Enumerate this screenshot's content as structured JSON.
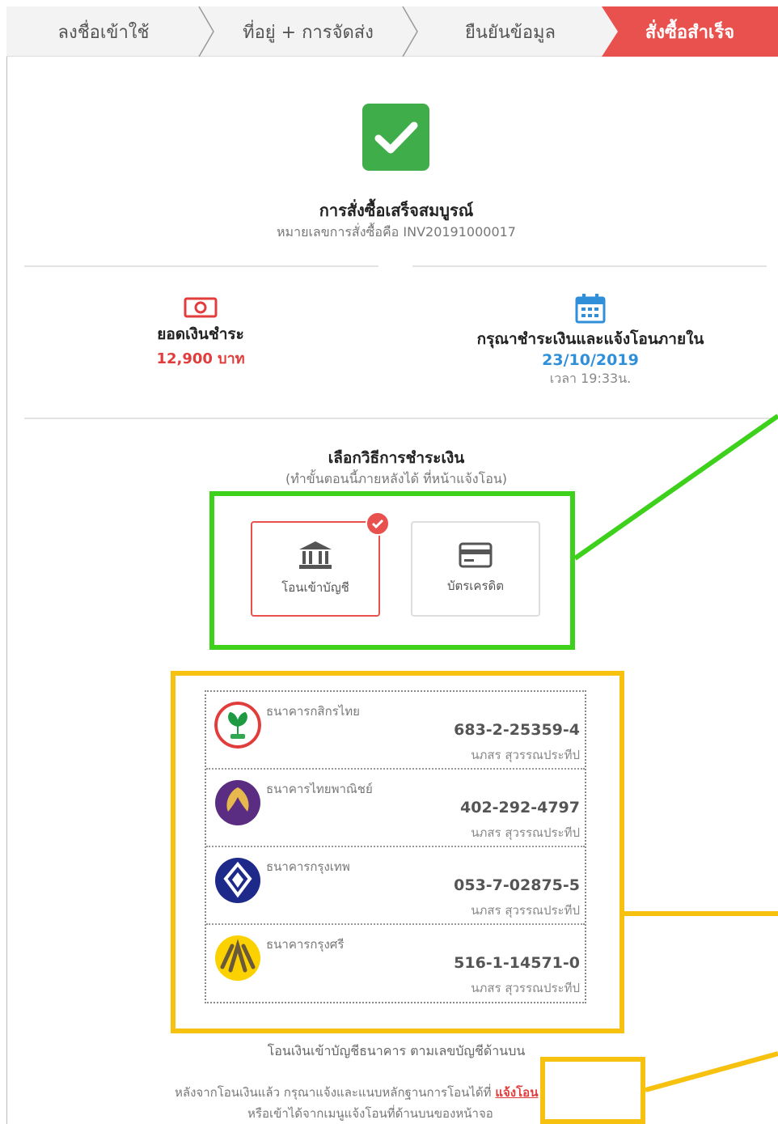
{
  "stepper": {
    "steps": [
      "ลงชื่อเข้าใช้",
      "ที่อยู่ + การจัดส่ง",
      "ยืนยันข้อมูล",
      "สั่งซื้อสำเร็จ"
    ],
    "active_color": "#e9514f"
  },
  "success": {
    "icon": "check-icon",
    "title": "การสั่งซื้อเสร็จสมบูรณ์",
    "order_number": "หมายเลขการสั่งซื้อคือ INV20191000017"
  },
  "payment_summary": {
    "amount_icon": "money-icon",
    "amount_label": "ยอดเงินชำระ",
    "amount_value": "12,900 บาท",
    "deadline_icon": "calendar-icon",
    "deadline_label": "กรุณาชำระเงินและแจ้งโอนภายใน",
    "deadline_date": "23/10/2019",
    "deadline_time": "เวลา 19:33น."
  },
  "payment_method": {
    "title": "เลือกวิธีการชำระเงิน",
    "subtitle": "(ทำขั้นตอนนี้ภายหลังได้ ที่หน้าแจ้งโอน)",
    "options": [
      {
        "label": "โอนเข้าบัญชี",
        "icon": "bank-icon",
        "selected": true
      },
      {
        "label": "บัตรเครดิต",
        "icon": "credit-card-icon",
        "selected": false
      }
    ]
  },
  "banks": [
    {
      "name": "ธนาคารกสิกรไทย",
      "account": "683-2-25359-4",
      "holder": "นภสร สุวรรณประทีป",
      "color": "#e23d3d",
      "icon": "kasikorn-logo-icon"
    },
    {
      "name": "ธนาคารไทยพาณิชย์",
      "account": "402-292-4797",
      "holder": "นภสร สุวรรณประทีป",
      "color": "#5a2d82",
      "icon": "scb-logo-icon"
    },
    {
      "name": "ธนาคารกรุงเทพ",
      "account": "053-7-02875-5",
      "holder": "นภสร สุวรรณประทีป",
      "color": "#1e2a8a",
      "icon": "bangkok-bank-logo-icon"
    },
    {
      "name": "ธนาคารกรุงศรี",
      "account": "516-1-14571-0",
      "holder": "นภสร สุวรรณประทีป",
      "color": "#fbd100",
      "icon": "krungsri-logo-icon"
    }
  ],
  "footer": {
    "transfer_note": "โอนเงินเข้าบัญชีธนาคาร ตามเลขบัญชีด้านบน",
    "after_transfer_prefix": "หลังจากโอนเงินแล้ว กรุณาแจ้งและแนบหลักฐานการโอนได้ที่",
    "notify_link": "แจ้งโอน",
    "menu_note": "หรือเข้าได้จากเมนูแจ้งโอนที่ด้านบนของหน้าจอ"
  }
}
